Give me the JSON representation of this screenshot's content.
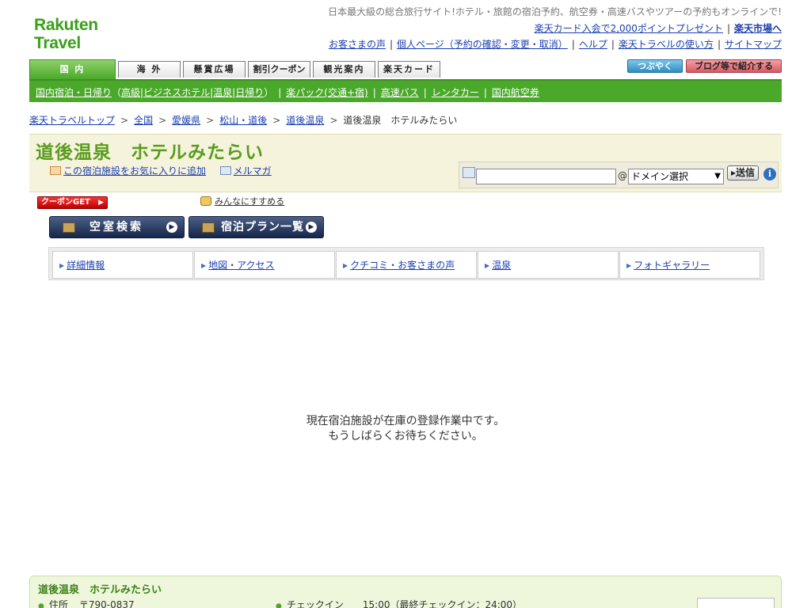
{
  "logo": {
    "line1": "Rakuten",
    "line2": "Travel"
  },
  "header": {
    "tagline": "日本最大級の総合旅行サイト!ホテル・旅館の宿泊予約、航空券・高速バスやツアーの予約もオンラインで!",
    "links_row1": [
      "楽天カード入会で2,000ポイントプレゼント",
      "楽天市場へ"
    ],
    "links_row2": [
      "お客さまの声",
      "個人ページ（予約の確認・変更・取消）",
      "ヘルプ",
      "楽天トラベルの使い方",
      "サイトマップ"
    ]
  },
  "tabs": [
    "国 内",
    "海 外",
    "懸賞広場",
    "割引クーポン",
    "観光案内",
    "楽天カード"
  ],
  "share": {
    "tweet": "つぶやく",
    "blog": "ブログ等で紹介する"
  },
  "green_nav": {
    "domestic": "国内宿泊・日帰り",
    "open_paren": "（",
    "luxury": "高級",
    "business": "ビジネスホテル",
    "onsen": "温泉",
    "dayuse": "日帰り",
    "close_paren": "）",
    "rakupack": "楽パック(交通+宿)",
    "bus": "高速バス",
    "rentacar": "レンタカー",
    "air": "国内航空券"
  },
  "breadcrumb": {
    "items": [
      "楽天トラベルトップ",
      "全国",
      "愛媛県",
      "松山・道後",
      "道後温泉"
    ],
    "separator": ">",
    "current": "道後温泉　ホテルみたらい"
  },
  "hotel": {
    "title": "道後温泉　ホテルみたらい"
  },
  "actions": {
    "favorite": "この宿泊施設をお気に入りに追加",
    "mailmag": "メルマガ"
  },
  "mail_form": {
    "at": "@",
    "domain_select": "ドメイン選択",
    "send": "送信",
    "help": "i"
  },
  "coupon": {
    "label": "クーポンGET"
  },
  "recommend": "みんなにすすめる",
  "buttons": {
    "vacancy": "空室検索",
    "plans": "宿泊プラン一覧"
  },
  "subtabs": [
    "詳細情報",
    "地図・アクセス",
    "クチコミ・お客さまの声",
    "温泉",
    "フォトギャラリー"
  ],
  "notice": {
    "line1": "現在宿泊施設が在庫の登録作業中です。",
    "line2": "もうしばらくお待ちください。"
  },
  "footer": {
    "title": "道後温泉　ホテルみたらい",
    "address_label": "住所",
    "address_value": "〒790-0837",
    "checkin_label": "チェックイン",
    "checkin_value": "15:00（最終チェックイン：24:00）"
  }
}
